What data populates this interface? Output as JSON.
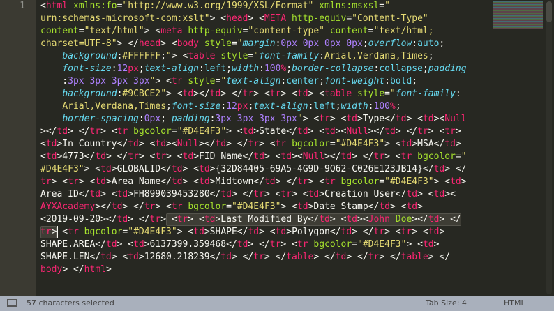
{
  "gutter": {
    "line_number": "1"
  },
  "code_lines": [
    [
      [
        "p",
        "<"
      ],
      [
        "t",
        "html"
      ],
      [
        "a",
        " xmlns:fo"
      ],
      [
        "p",
        "="
      ],
      [
        "s",
        "\"http://www.w3.org/1999/XSL/Format\""
      ],
      [
        "a",
        " xmlns:msxsl"
      ],
      [
        "p",
        "="
      ],
      [
        "s",
        "\""
      ]
    ],
    [
      [
        "s",
        "urn:schemas-microsoft-com:xslt\""
      ],
      [
        "p",
        "> <"
      ],
      [
        "t",
        "head"
      ],
      [
        "p",
        "> <"
      ],
      [
        "t",
        "META"
      ],
      [
        "a",
        " http-equiv"
      ],
      [
        "p",
        "="
      ],
      [
        "s",
        "\"Content-Type\""
      ]
    ],
    [
      [
        "a",
        "content"
      ],
      [
        "p",
        "="
      ],
      [
        "s",
        "\"text/html\""
      ],
      [
        "p",
        "> <"
      ],
      [
        "t",
        "meta"
      ],
      [
        "a",
        " http-equiv"
      ],
      [
        "p",
        "="
      ],
      [
        "s",
        "\"content-type\""
      ],
      [
        "a",
        " content"
      ],
      [
        "p",
        "="
      ],
      [
        "s",
        "\"text/html;"
      ]
    ],
    [
      [
        "s",
        "charset=UTF-8\""
      ],
      [
        "p",
        "> </"
      ],
      [
        "t",
        "head"
      ],
      [
        "p",
        "> <"
      ],
      [
        "t",
        "body"
      ],
      [
        "a",
        " style"
      ],
      [
        "p",
        "="
      ],
      [
        "s",
        "\""
      ],
      [
        "k",
        "margin"
      ],
      [
        "p",
        ":"
      ],
      [
        "n",
        "0px 0px 0px 0px"
      ],
      [
        "p",
        ";"
      ],
      [
        "k",
        "overflow"
      ],
      [
        "p",
        ":"
      ],
      [
        "v",
        "auto"
      ],
      [
        "p",
        ";"
      ]
    ],
    [
      [
        "p",
        "    "
      ],
      [
        "k",
        "background"
      ],
      [
        "p",
        ":"
      ],
      [
        "s",
        "#FFFFFF"
      ],
      [
        "p",
        ";"
      ],
      [
        "s",
        "\""
      ],
      [
        "p",
        "> <"
      ],
      [
        "t",
        "table"
      ],
      [
        "a",
        " style"
      ],
      [
        "p",
        "="
      ],
      [
        "s",
        "\""
      ],
      [
        "k",
        "font-family"
      ],
      [
        "p",
        ":"
      ],
      [
        "s",
        "Arial,Verdana,Times"
      ],
      [
        "p",
        ";"
      ]
    ],
    [
      [
        "p",
        "    "
      ],
      [
        "k",
        "font-size"
      ],
      [
        "p",
        ":"
      ],
      [
        "n",
        "12"
      ],
      [
        "u",
        "px"
      ],
      [
        "p",
        ";"
      ],
      [
        "k",
        "text-align"
      ],
      [
        "p",
        ":"
      ],
      [
        "v",
        "left"
      ],
      [
        "p",
        ";"
      ],
      [
        "k",
        "width"
      ],
      [
        "p",
        ":"
      ],
      [
        "n",
        "100"
      ],
      [
        "u",
        "%"
      ],
      [
        "p",
        ";"
      ],
      [
        "k",
        "border-collapse"
      ],
      [
        "p",
        ":"
      ],
      [
        "v",
        "collapse"
      ],
      [
        "p",
        ";"
      ],
      [
        "k",
        "padding"
      ]
    ],
    [
      [
        "p",
        "    :"
      ],
      [
        "n",
        "3px 3px 3px 3px"
      ],
      [
        "s",
        "\""
      ],
      [
        "p",
        "> <"
      ],
      [
        "t",
        "tr"
      ],
      [
        "a",
        " style"
      ],
      [
        "p",
        "="
      ],
      [
        "s",
        "\""
      ],
      [
        "k",
        "text-align"
      ],
      [
        "p",
        ":"
      ],
      [
        "v",
        "center"
      ],
      [
        "p",
        ";"
      ],
      [
        "k",
        "font-weight"
      ],
      [
        "p",
        ":"
      ],
      [
        "v",
        "bold"
      ],
      [
        "p",
        ";"
      ]
    ],
    [
      [
        "p",
        "    "
      ],
      [
        "k",
        "background"
      ],
      [
        "p",
        ":"
      ],
      [
        "s",
        "#9CBCE2"
      ],
      [
        "s",
        "\""
      ],
      [
        "p",
        "> <"
      ],
      [
        "t",
        "td"
      ],
      [
        "p",
        "></"
      ],
      [
        "t",
        "td"
      ],
      [
        "p",
        "> </"
      ],
      [
        "t",
        "tr"
      ],
      [
        "p",
        "> <"
      ],
      [
        "t",
        "tr"
      ],
      [
        "p",
        "> <"
      ],
      [
        "t",
        "td"
      ],
      [
        "p",
        "> <"
      ],
      [
        "t",
        "table"
      ],
      [
        "a",
        " style"
      ],
      [
        "p",
        "="
      ],
      [
        "s",
        "\""
      ],
      [
        "k",
        "font-family"
      ],
      [
        "p",
        ":"
      ]
    ],
    [
      [
        "p",
        "    "
      ],
      [
        "s",
        "Arial,Verdana,Times"
      ],
      [
        "p",
        ";"
      ],
      [
        "k",
        "font-size"
      ],
      [
        "p",
        ":"
      ],
      [
        "n",
        "12"
      ],
      [
        "u",
        "px"
      ],
      [
        "p",
        ";"
      ],
      [
        "k",
        "text-align"
      ],
      [
        "p",
        ":"
      ],
      [
        "v",
        "left"
      ],
      [
        "p",
        ";"
      ],
      [
        "k",
        "width"
      ],
      [
        "p",
        ":"
      ],
      [
        "n",
        "100"
      ],
      [
        "u",
        "%"
      ],
      [
        "p",
        ";"
      ]
    ],
    [
      [
        "p",
        "    "
      ],
      [
        "k",
        "border-spacing"
      ],
      [
        "p",
        ":"
      ],
      [
        "n",
        "0px"
      ],
      [
        "p",
        "; "
      ],
      [
        "k",
        "padding"
      ],
      [
        "p",
        ":"
      ],
      [
        "n",
        "3px 3px 3px 3px"
      ],
      [
        "s",
        "\""
      ],
      [
        "p",
        "> <"
      ],
      [
        "t",
        "tr"
      ],
      [
        "p",
        "> <"
      ],
      [
        "t",
        "td"
      ],
      [
        "p",
        ">Type</"
      ],
      [
        "t",
        "td"
      ],
      [
        "p",
        "> <"
      ],
      [
        "t",
        "td"
      ],
      [
        "p",
        "><"
      ],
      [
        "t",
        "Null"
      ]
    ],
    [
      [
        "p",
        "></"
      ],
      [
        "t",
        "td"
      ],
      [
        "p",
        "> </"
      ],
      [
        "t",
        "tr"
      ],
      [
        "p",
        "> <"
      ],
      [
        "t",
        "tr"
      ],
      [
        "a",
        " bgcolor"
      ],
      [
        "p",
        "="
      ],
      [
        "s",
        "\"#D4E4F3\""
      ],
      [
        "p",
        "> <"
      ],
      [
        "t",
        "td"
      ],
      [
        "p",
        ">State</"
      ],
      [
        "t",
        "td"
      ],
      [
        "p",
        "> <"
      ],
      [
        "t",
        "td"
      ],
      [
        "p",
        "><"
      ],
      [
        "t",
        "Null"
      ],
      [
        "p",
        "></"
      ],
      [
        "t",
        "td"
      ],
      [
        "p",
        "> </"
      ],
      [
        "t",
        "tr"
      ],
      [
        "p",
        "> <"
      ],
      [
        "t",
        "tr"
      ],
      [
        "p",
        ">"
      ]
    ],
    [
      [
        "p",
        "<"
      ],
      [
        "t",
        "td"
      ],
      [
        "p",
        ">In Country</"
      ],
      [
        "t",
        "td"
      ],
      [
        "p",
        "> <"
      ],
      [
        "t",
        "td"
      ],
      [
        "p",
        "><"
      ],
      [
        "t",
        "Null"
      ],
      [
        "p",
        "></"
      ],
      [
        "t",
        "td"
      ],
      [
        "p",
        "> </"
      ],
      [
        "t",
        "tr"
      ],
      [
        "p",
        "> <"
      ],
      [
        "t",
        "tr"
      ],
      [
        "a",
        " bgcolor"
      ],
      [
        "p",
        "="
      ],
      [
        "s",
        "\"#D4E4F3\""
      ],
      [
        "p",
        "> <"
      ],
      [
        "t",
        "td"
      ],
      [
        "p",
        ">MSA</"
      ],
      [
        "t",
        "td"
      ],
      [
        "p",
        ">"
      ]
    ],
    [
      [
        "p",
        "<"
      ],
      [
        "t",
        "td"
      ],
      [
        "p",
        ">4773</"
      ],
      [
        "t",
        "td"
      ],
      [
        "p",
        "> </"
      ],
      [
        "t",
        "tr"
      ],
      [
        "p",
        "> <"
      ],
      [
        "t",
        "tr"
      ],
      [
        "p",
        "> <"
      ],
      [
        "t",
        "td"
      ],
      [
        "p",
        ">FID Name</"
      ],
      [
        "t",
        "td"
      ],
      [
        "p",
        "> <"
      ],
      [
        "t",
        "td"
      ],
      [
        "p",
        "><"
      ],
      [
        "t",
        "Null"
      ],
      [
        "p",
        "></"
      ],
      [
        "t",
        "td"
      ],
      [
        "p",
        "> </"
      ],
      [
        "t",
        "tr"
      ],
      [
        "p",
        "> <"
      ],
      [
        "t",
        "tr"
      ],
      [
        "a",
        " bgcolor"
      ],
      [
        "p",
        "="
      ],
      [
        "s",
        "\""
      ]
    ],
    [
      [
        "s",
        "#D4E4F3\""
      ],
      [
        "p",
        "> <"
      ],
      [
        "t",
        "td"
      ],
      [
        "p",
        ">GLOBALID</"
      ],
      [
        "t",
        "td"
      ],
      [
        "p",
        "> <"
      ],
      [
        "t",
        "td"
      ],
      [
        "p",
        ">{32D84405-69A5-4G9D-9Q62-C026E123JB14}</"
      ],
      [
        "t",
        "td"
      ],
      [
        "p",
        "> </"
      ]
    ],
    [
      [
        "t",
        "tr"
      ],
      [
        "p",
        "> <"
      ],
      [
        "t",
        "tr"
      ],
      [
        "p",
        "> <"
      ],
      [
        "t",
        "td"
      ],
      [
        "p",
        ">Area Name</"
      ],
      [
        "t",
        "td"
      ],
      [
        "p",
        "> <"
      ],
      [
        "t",
        "td"
      ],
      [
        "p",
        ">Midtown</"
      ],
      [
        "t",
        "td"
      ],
      [
        "p",
        "> </"
      ],
      [
        "t",
        "tr"
      ],
      [
        "p",
        "> <"
      ],
      [
        "t",
        "tr"
      ],
      [
        "a",
        " bgcolor"
      ],
      [
        "p",
        "="
      ],
      [
        "s",
        "\"#D4E4F3\""
      ],
      [
        "p",
        "> <"
      ],
      [
        "t",
        "td"
      ],
      [
        "p",
        ">"
      ]
    ],
    [
      [
        "p",
        "Area ID</"
      ],
      [
        "t",
        "td"
      ],
      [
        "p",
        "> <"
      ],
      [
        "t",
        "td"
      ],
      [
        "p",
        ">FH899039453280</"
      ],
      [
        "t",
        "td"
      ],
      [
        "p",
        "> </"
      ],
      [
        "t",
        "tr"
      ],
      [
        "p",
        "> <"
      ],
      [
        "t",
        "tr"
      ],
      [
        "p",
        "> <"
      ],
      [
        "t",
        "td"
      ],
      [
        "p",
        ">Creation User</"
      ],
      [
        "t",
        "td"
      ],
      [
        "p",
        "> <"
      ],
      [
        "t",
        "td"
      ],
      [
        "p",
        "><"
      ]
    ],
    [
      [
        "t",
        "AYXAcademy"
      ],
      [
        "p",
        "></"
      ],
      [
        "t",
        "td"
      ],
      [
        "p",
        "> </"
      ],
      [
        "t",
        "tr"
      ],
      [
        "p",
        "> <"
      ],
      [
        "t",
        "tr"
      ],
      [
        "a",
        " bgcolor"
      ],
      [
        "p",
        "="
      ],
      [
        "s",
        "\"#D4E4F3\""
      ],
      [
        "p",
        "> <"
      ],
      [
        "t",
        "td"
      ],
      [
        "p",
        ">Date Stamp</"
      ],
      [
        "t",
        "td"
      ],
      [
        "p",
        "> <"
      ],
      [
        "t",
        "td"
      ],
      [
        "p",
        ">"
      ]
    ],
    [
      [
        "p",
        "<2019-09-20></"
      ],
      [
        "t",
        "td"
      ],
      [
        "p",
        "> </"
      ],
      [
        "t",
        "tr"
      ],
      [
        "p",
        "> <"
      ],
      [
        "t",
        "tr"
      ],
      [
        "p",
        "> <"
      ],
      [
        "t",
        "td"
      ],
      [
        "p",
        ">Last Modified By</"
      ],
      [
        "t",
        "td"
      ],
      [
        "p",
        "> <"
      ],
      [
        "t",
        "td"
      ],
      [
        "p",
        "><"
      ],
      [
        "t",
        "John"
      ],
      [
        "a",
        " Doe"
      ],
      [
        "p",
        "></"
      ],
      [
        "t",
        "td"
      ],
      [
        "p",
        "> </"
      ]
    ],
    [
      [
        "t",
        "tr"
      ],
      [
        "p",
        "> <"
      ],
      [
        "t",
        "tr"
      ],
      [
        "a",
        " bgcolor"
      ],
      [
        "p",
        "="
      ],
      [
        "s",
        "\"#D4E4F3\""
      ],
      [
        "p",
        "> <"
      ],
      [
        "t",
        "td"
      ],
      [
        "p",
        ">SHAPE</"
      ],
      [
        "t",
        "td"
      ],
      [
        "p",
        "> <"
      ],
      [
        "t",
        "td"
      ],
      [
        "p",
        ">Polygon</"
      ],
      [
        "t",
        "td"
      ],
      [
        "p",
        "> </"
      ],
      [
        "t",
        "tr"
      ],
      [
        "p",
        "> <"
      ],
      [
        "t",
        "tr"
      ],
      [
        "p",
        "> <"
      ],
      [
        "t",
        "td"
      ],
      [
        "p",
        ">"
      ]
    ],
    [
      [
        "p",
        "SHAPE.AREA</"
      ],
      [
        "t",
        "td"
      ],
      [
        "p",
        "> <"
      ],
      [
        "t",
        "td"
      ],
      [
        "p",
        ">6137399.359468</"
      ],
      [
        "t",
        "td"
      ],
      [
        "p",
        "> </"
      ],
      [
        "t",
        "tr"
      ],
      [
        "p",
        "> <"
      ],
      [
        "t",
        "tr"
      ],
      [
        "a",
        " bgcolor"
      ],
      [
        "p",
        "="
      ],
      [
        "s",
        "\"#D4E4F3\""
      ],
      [
        "p",
        "> <"
      ],
      [
        "t",
        "td"
      ],
      [
        "p",
        ">"
      ]
    ],
    [
      [
        "p",
        "SHAPE.LEN</"
      ],
      [
        "t",
        "td"
      ],
      [
        "p",
        "> <"
      ],
      [
        "t",
        "td"
      ],
      [
        "p",
        ">12680.218239</"
      ],
      [
        "t",
        "td"
      ],
      [
        "p",
        "> </"
      ],
      [
        "t",
        "tr"
      ],
      [
        "p",
        "> </"
      ],
      [
        "t",
        "table"
      ],
      [
        "p",
        "> </"
      ],
      [
        "t",
        "td"
      ],
      [
        "p",
        "> </"
      ],
      [
        "t",
        "tr"
      ],
      [
        "p",
        "> </"
      ],
      [
        "t",
        "table"
      ],
      [
        "p",
        "> </"
      ]
    ],
    [
      [
        "t",
        "body"
      ],
      [
        "p",
        "> </"
      ],
      [
        "t",
        "html"
      ],
      [
        "p",
        ">"
      ]
    ]
  ],
  "status_bar": {
    "selection": "57 characters selected",
    "tab_size": "Tab Size: 4",
    "syntax": "HTML"
  }
}
